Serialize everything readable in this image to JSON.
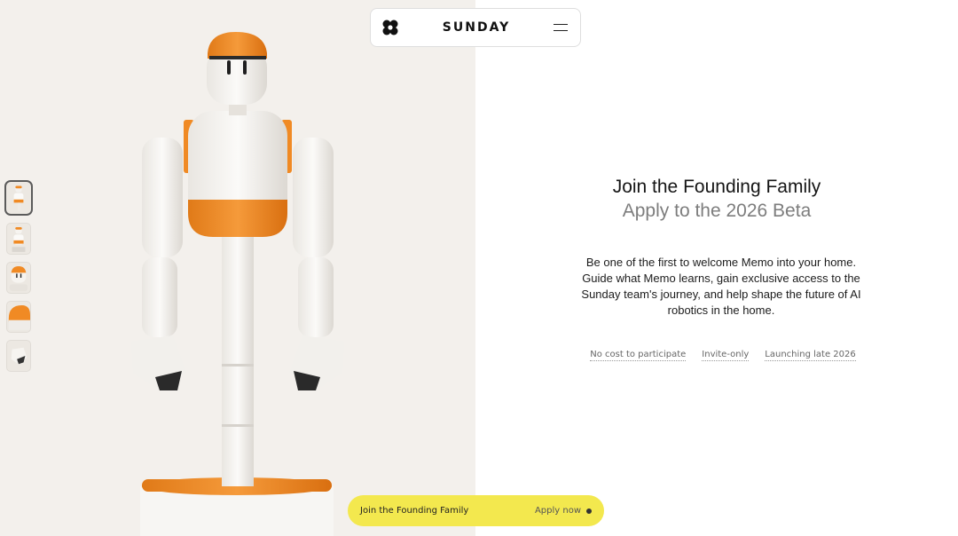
{
  "header": {
    "brand": "SUNDAY",
    "logo_icon": "flower-logo-icon",
    "menu_icon": "hamburger-menu-icon"
  },
  "hero": {
    "image": "robot-memo",
    "thumbnails": [
      "robot-front",
      "robot-side",
      "robot-head",
      "robot-cap",
      "robot-hand"
    ],
    "active_thumbnail": 0
  },
  "main": {
    "title": "Join the Founding Family",
    "subtitle": "Apply to the 2026 Beta",
    "description": "Be one of the first to welcome Memo into your home. Guide what Memo learns, gain exclusive access to the Sunday team's journey, and help shape the future of AI robotics in the home.",
    "tags": [
      "No cost to participate",
      "Invite-only",
      "Launching late 2026"
    ]
  },
  "cta": {
    "label": "Join the Founding Family",
    "action": "Apply now"
  },
  "colors": {
    "accent_orange": "#f08a24",
    "cta_yellow": "#f3e84e",
    "hero_bg": "#f3f0ec"
  }
}
